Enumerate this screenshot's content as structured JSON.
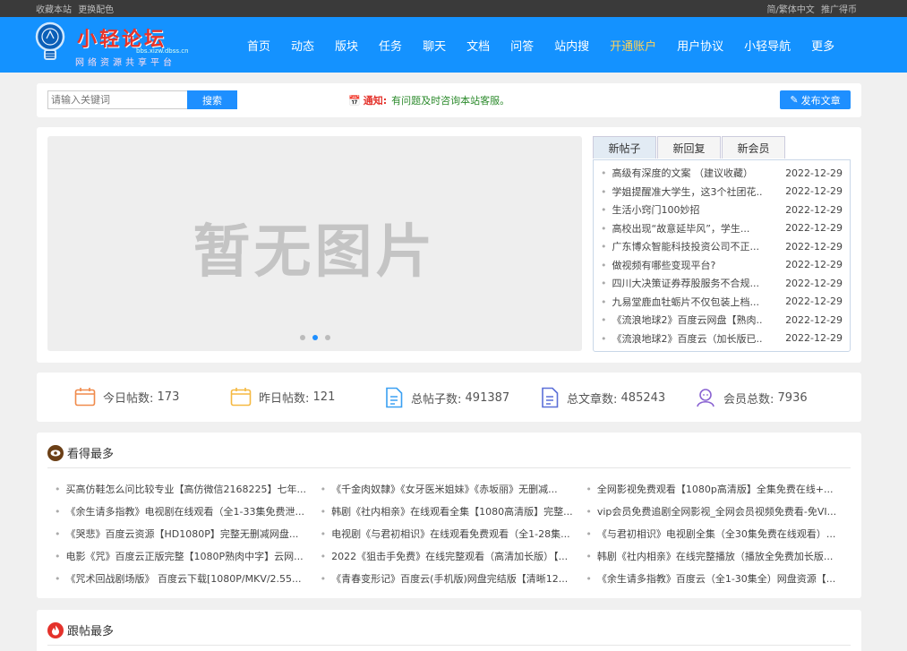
{
  "topbar": {
    "left": [
      "收藏本站",
      "更换配色"
    ],
    "right": [
      "简/繁体中文",
      "推广得币"
    ]
  },
  "logo": {
    "title": "小轻论坛",
    "url": "bbs.xizw.dbss.cn",
    "subtitle": "网络资源共享平台"
  },
  "nav": [
    "首页",
    "动态",
    "版块",
    "任务",
    "聊天",
    "文档",
    "问答",
    "站内搜",
    "开通账户",
    "用户协议",
    "小轻导航",
    "更多"
  ],
  "nav_active": "开通账户",
  "search": {
    "placeholder": "请输入关键词",
    "button": "搜索"
  },
  "notice": {
    "label": "通知:",
    "text": "有问题及时咨询本站客服。"
  },
  "publish_button": "发布文章",
  "slider": {
    "placeholder": "暂无图片",
    "dots": 3,
    "active_dot": 2
  },
  "tabs": [
    "新帖子",
    "新回复",
    "新会员"
  ],
  "posts": [
    {
      "title": "高级有深度的文案 （建议收藏）",
      "date": "2022-12-29"
    },
    {
      "title": "学姐提醒准大学生，这3个社团花...",
      "date": "2022-12-29"
    },
    {
      "title": "生活小窍门100妙招",
      "date": "2022-12-29"
    },
    {
      "title": "高校出现“故意延毕风”，学生...",
      "date": "2022-12-29"
    },
    {
      "title": "广东博众智能科技投资公司不正...",
      "date": "2022-12-29"
    },
    {
      "title": "做视频有哪些变现平台?",
      "date": "2022-12-29"
    },
    {
      "title": "四川大决策证券荐股服务不合规...",
      "date": "2022-12-29"
    },
    {
      "title": "九易堂鹿血牡蛎片不仅包装上档...",
      "date": "2022-12-29"
    },
    {
      "title": "《流浪地球2》百度云网盘【熟肉...",
      "date": "2022-12-29"
    },
    {
      "title": "《流浪地球2》百度云（加长版已...",
      "date": "2022-12-29"
    }
  ],
  "stats": [
    {
      "label": "今日帖数:",
      "value": "173",
      "color": "#f08a4b"
    },
    {
      "label": "昨日帖数:",
      "value": "121",
      "color": "#f5b942"
    },
    {
      "label": "总帖子数:",
      "value": "491387",
      "color": "#3aa0f2"
    },
    {
      "label": "总文章数:",
      "value": "485243",
      "color": "#5b6fd8"
    },
    {
      "label": "会员总数:",
      "value": "7936",
      "color": "#8a63d2"
    }
  ],
  "most_viewed": {
    "title": "看得最多",
    "rows": [
      [
        "买高仿鞋怎么问比较专业【高仿微信2168225】七年...",
        "《千金肉奴隸》《女牙医米姐妹》《赤坂丽》无删减...",
        "全网影视免费观看【1080p高清版】全集免费在线+..."
      ],
      [
        "《余生请多指教》电视剧在线观看（全1-33集免费泄...",
        "韩剧《社内相亲》在线观看全集【1080高清版】完整...",
        "vip会员免费追剧全网影视_全网会员视频免费看-免VI..."
      ],
      [
        "《哭悲》百度云资源【HD1080P】完整无删减网盘...",
        "电视剧《与君初相识》在线观看免费观看（全1-28集...",
        "《与君初相识》电视剧全集（全30集免费在线观看）..."
      ],
      [
        "电影《咒》百度云正版完整【1080P熟肉中字】云网...",
        "2022《狙击手免费》在线完整观看（高清加长版）【...",
        "韩剧《社内相亲》在线完整播放（播放全免费加长版..."
      ],
      [
        "《咒术回战剧场版》 百度云下载[1080P/MKV/2.55...",
        "《青春变形记》百度云(手机版)网盘完结版【清晰12...",
        "《余生请多指教》百度云（全1-30集全）网盘资源【..."
      ]
    ]
  },
  "most_replied": {
    "title": "跟帖最多"
  }
}
